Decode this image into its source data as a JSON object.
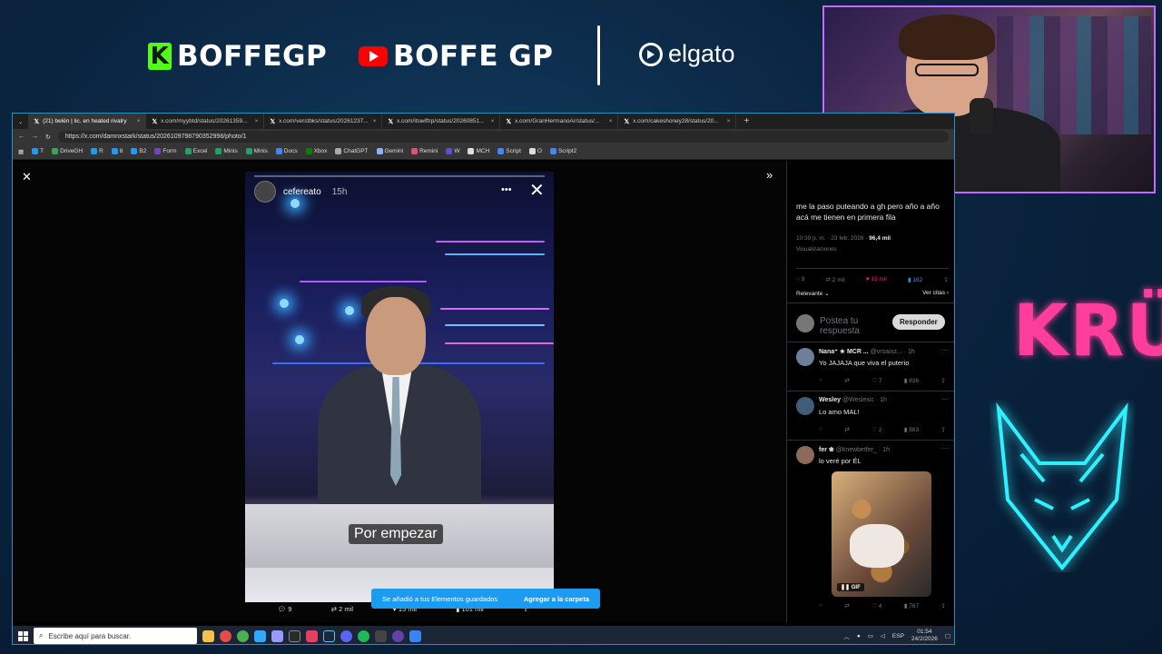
{
  "overlay": {
    "kick_handle": "BOFFEGP",
    "youtube_handle": "BOFFE GP",
    "sponsor": "elgato",
    "team_logo": "KRÜ",
    "colors": {
      "kick_green": "#53fc18",
      "youtube_red": "#ff0000",
      "kru_pink": "#ff3d9a",
      "fox_cyan": "#2ff0ff"
    }
  },
  "browser": {
    "tabs": [
      {
        "label": "(21) belén | lic. en heated rivalry",
        "icon": "x-icon",
        "active": true
      },
      {
        "label": "x.com/myybtd/status/20261359...",
        "icon": "x-icon"
      },
      {
        "label": "x.com/verstbks/status/20261237...",
        "icon": "x-icon"
      },
      {
        "label": "x.com/itswiftrp/status/20260851...",
        "icon": "x-icon"
      },
      {
        "label": "x.com/GranHermanoAr/status/...",
        "icon": "x-icon"
      },
      {
        "label": "x.com/cakeshoney28/status/20...",
        "icon": "x-icon"
      }
    ],
    "url": "https://x.com/damnxstark/status/2026109798790352998/photo/1",
    "bookmarks": [
      "T",
      "DriveGH",
      "R",
      "8",
      "B2",
      "Form",
      "Excel",
      "Minis",
      "Minis",
      "Docs",
      "Xbox",
      "ChatGPT",
      "Gemini",
      "Remini",
      "W",
      "MCH",
      "Script",
      "O",
      "Script2"
    ]
  },
  "viewer": {
    "story_user": "cefereato",
    "story_time": "15h",
    "caption": "Por empezar",
    "actions": {
      "replies": "9",
      "reposts": "2 mil",
      "likes": "15 mil",
      "views": "101 mil"
    },
    "toast": {
      "message": "Se añadió a tus Elementos guardados",
      "action": "Agregar a la carpeta"
    }
  },
  "thread": {
    "main_text": "me la paso puteando a gh pero año a año acá me tienen en primera fila",
    "timestamp": "10:39 p. m. · 23 feb. 2026 ·",
    "views": "96,4 mil",
    "views_label": "Visualizaciones",
    "stats": {
      "replies": "9",
      "reposts": "2 mil",
      "likes": "15 mil",
      "bookmarks": "162"
    },
    "sort_label": "Relevante",
    "quotes_link": "Ver citas",
    "reply_placeholder": "Postea tu respuesta",
    "reply_button": "Responder",
    "replies": [
      {
        "name": "Nana⁺ ★ MCR ...",
        "handle": "@vrsainz... · 1h",
        "text": "Yo JAJAJA que viva el puterio",
        "likes": "7",
        "views": "836"
      },
      {
        "name": "Wesley",
        "handle": "@Weslexic · 1h",
        "text": "Lo amo MAL!",
        "likes": "2",
        "views": "883"
      },
      {
        "name": "fer ❀",
        "handle": "@knewbetfer_ · 1h",
        "text": "lo veré por ÉL",
        "likes": "4",
        "views": "767",
        "gif_badge": "GIF"
      }
    ]
  },
  "taskbar": {
    "search_placeholder": "Escribe aquí para buscar.",
    "language": "ESP",
    "time": "01:54",
    "date": "24/2/2026"
  }
}
